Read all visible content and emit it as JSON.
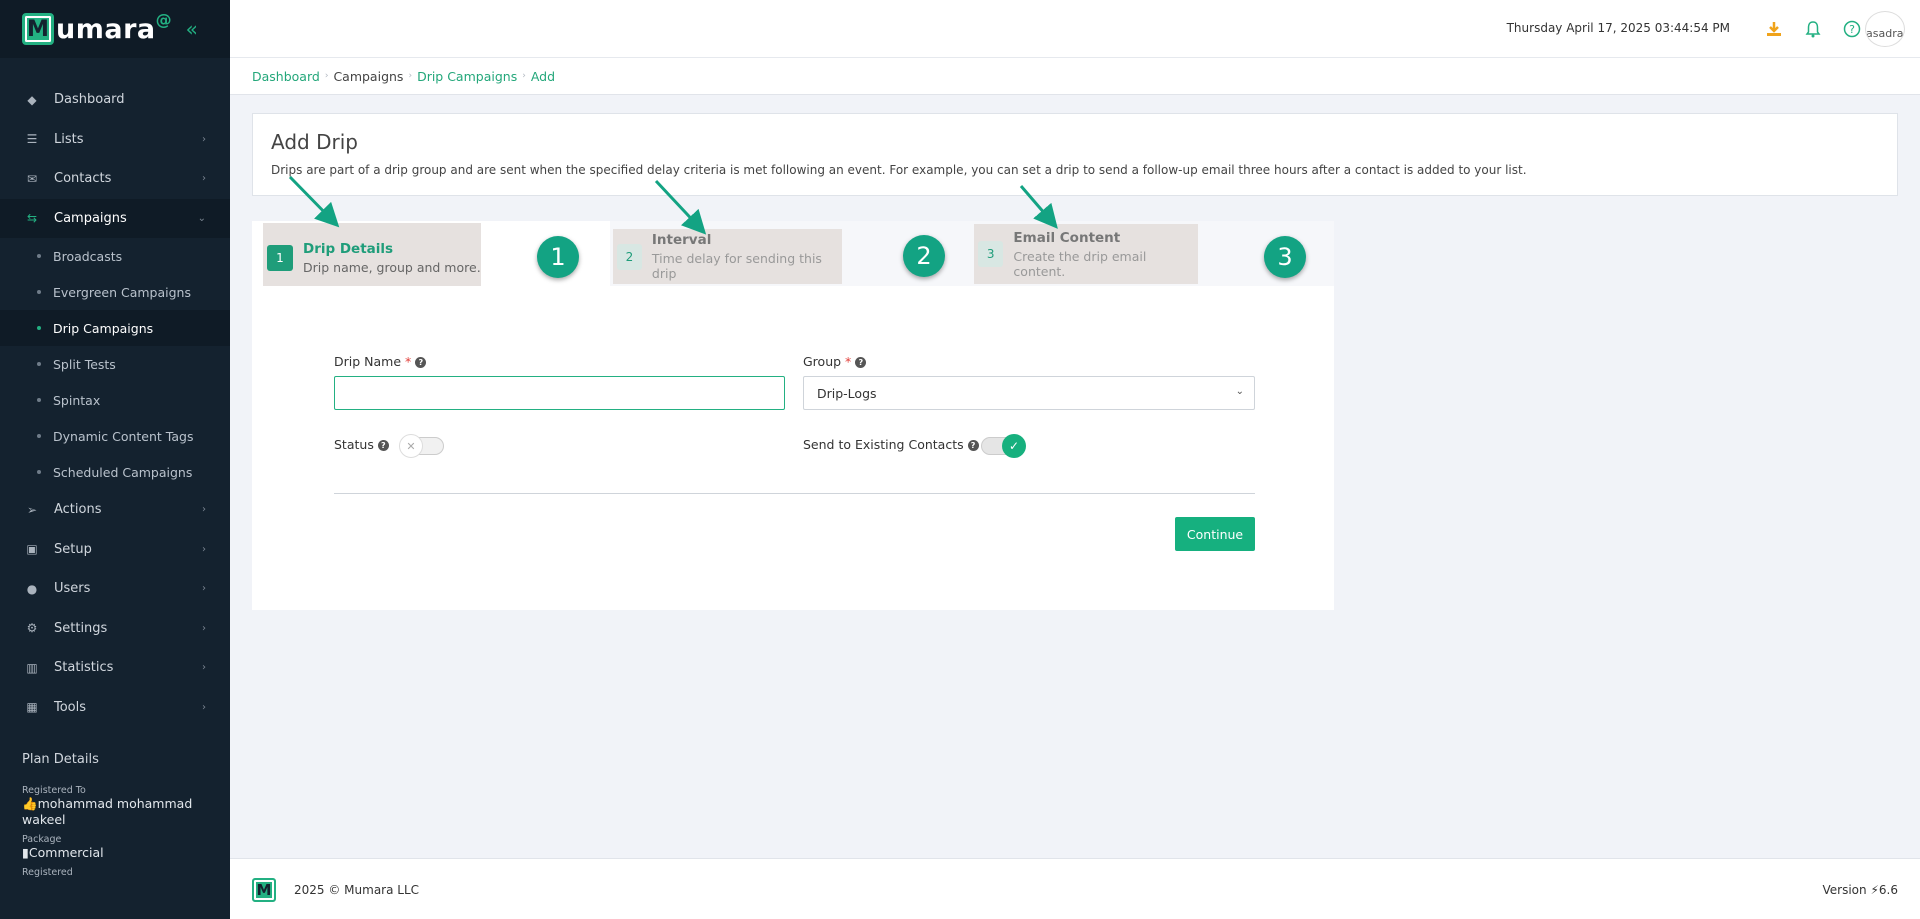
{
  "brand": {
    "letter": "M",
    "name": "umara",
    "at": "@",
    "collapse_glyph": "«"
  },
  "sidebar": {
    "items": [
      {
        "label": "Dashboard",
        "icon": "layers-icon",
        "glyph": "◆"
      },
      {
        "label": "Lists",
        "icon": "list-icon",
        "glyph": "☰"
      },
      {
        "label": "Contacts",
        "icon": "envelope-icon",
        "glyph": "✉"
      },
      {
        "label": "Campaigns",
        "icon": "campaigns-icon",
        "glyph": "⇆"
      },
      {
        "label": "Actions",
        "icon": "send-icon",
        "glyph": "➢"
      },
      {
        "label": "Setup",
        "icon": "toggle-icon",
        "glyph": "▣"
      },
      {
        "label": "Users",
        "icon": "user-icon",
        "glyph": "●"
      },
      {
        "label": "Settings",
        "icon": "gear-icon",
        "glyph": "⚙"
      },
      {
        "label": "Statistics",
        "icon": "bar-chart-icon",
        "glyph": "▥"
      },
      {
        "label": "Tools",
        "icon": "grid-icon",
        "glyph": "▦"
      }
    ],
    "sub_items": [
      "Broadcasts",
      "Evergreen Campaigns",
      "Drip Campaigns",
      "Split Tests",
      "Spintax",
      "Dynamic Content Tags",
      "Scheduled Campaigns"
    ],
    "plan": {
      "title": "Plan Details",
      "registered_to_label": "Registered To",
      "registered_to_value": "mohammad mohammad wakeel",
      "package_label": "Package",
      "package_value": "Commercial",
      "registered_label": "Registered"
    }
  },
  "header": {
    "datetime": "Thursday April 17, 2025 03:44:54 PM",
    "avatar_alt": "asadra",
    "accent_color": "#f0a31b",
    "icon_color": "#23b082"
  },
  "breadcrumb": [
    "Dashboard",
    "Campaigns",
    "Drip Campaigns",
    "Add"
  ],
  "page": {
    "title": "Add Drip",
    "description": "Drips are part of a drip group and are sent when the specified delay criteria is met following an event. For example, you can set a drip to send a follow-up email three hours after a contact is added to your list."
  },
  "steps": [
    {
      "num": "1",
      "title": "Drip Details",
      "desc": "Drip name, group and more.",
      "badge": "1",
      "active": true
    },
    {
      "num": "2",
      "title": "Interval",
      "desc": "Time delay for sending this drip",
      "badge": "2",
      "active": false
    },
    {
      "num": "3",
      "title": "Email Content",
      "desc": "Create the drip email content.",
      "badge": "3",
      "active": false
    }
  ],
  "form": {
    "drip_name_label": "Drip Name",
    "drip_name_value": "",
    "group_label": "Group",
    "group_value": "Drip-Logs",
    "status_label": "Status",
    "status_on": false,
    "send_existing_label": "Send to Existing Contacts",
    "send_existing_on": true,
    "required_mark": "*",
    "continue_label": "Continue"
  },
  "footer": {
    "logo_letter": "M",
    "copyright": "2025 © Mumara LLC",
    "version_label": "Version",
    "version_value": "6.6"
  },
  "colors": {
    "brand_green": "#23b082",
    "sidebar_bg": "#14222f",
    "badge_green": "#13a383"
  }
}
